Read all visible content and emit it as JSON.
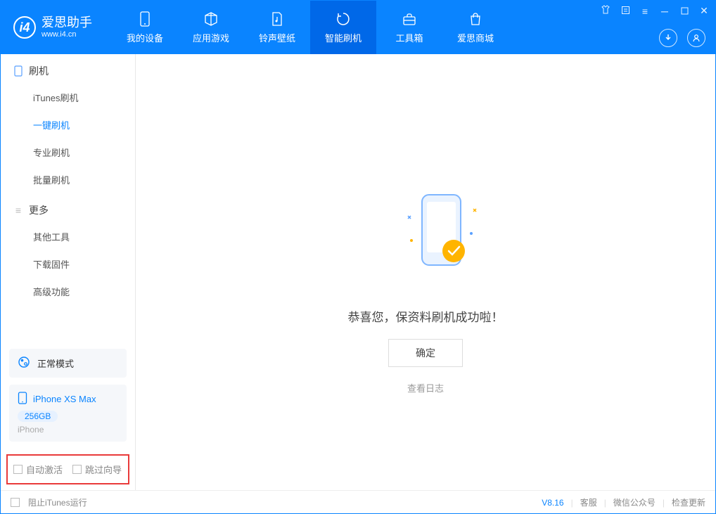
{
  "app": {
    "name": "爱思助手",
    "url": "www.i4.cn"
  },
  "tabs": [
    {
      "label": "我的设备"
    },
    {
      "label": "应用游戏"
    },
    {
      "label": "铃声壁纸"
    },
    {
      "label": "智能刷机"
    },
    {
      "label": "工具箱"
    },
    {
      "label": "爱思商城"
    }
  ],
  "sidebar": {
    "section1": {
      "title": "刷机",
      "items": [
        "iTunes刷机",
        "一键刷机",
        "专业刷机",
        "批量刷机"
      ]
    },
    "section2": {
      "title": "更多",
      "items": [
        "其他工具",
        "下载固件",
        "高级功能"
      ]
    }
  },
  "mode": {
    "label": "正常模式"
  },
  "device": {
    "name": "iPhone XS Max",
    "capacity": "256GB",
    "type": "iPhone"
  },
  "checks": {
    "auto_activate": "自动激活",
    "skip_guide": "跳过向导"
  },
  "main": {
    "success_text": "恭喜您，保资料刷机成功啦！",
    "confirm": "确定",
    "view_log": "查看日志"
  },
  "footer": {
    "block_itunes": "阻止iTunes运行",
    "version": "V8.16",
    "links": [
      "客服",
      "微信公众号",
      "检查更新"
    ]
  }
}
